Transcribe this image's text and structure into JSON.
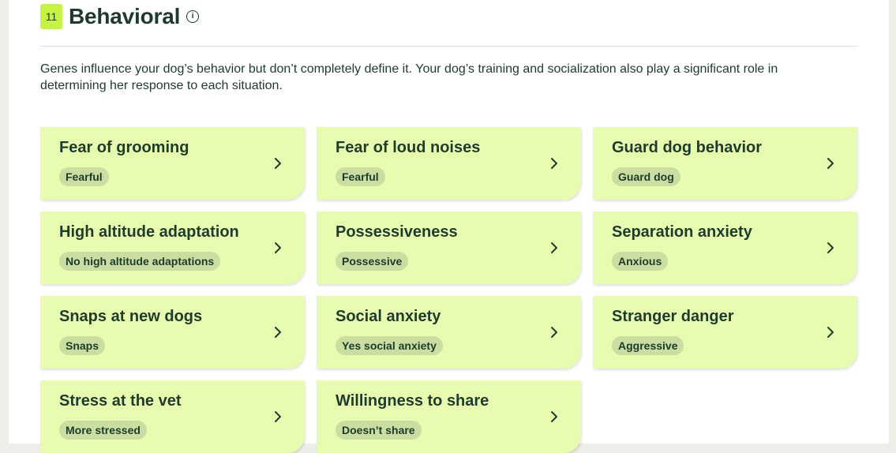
{
  "section": {
    "count": "11",
    "title": "Behavioral",
    "info_icon": "info-circle-icon",
    "description": "Genes influence your dog’s behavior but don’t completely define it. Your dog’s training and socialization also play a significant role in determining her response to each situation."
  },
  "colors": {
    "badge_count_bg": "#c5f542",
    "card_bg": "#e8fcb0",
    "pill_bg": "#c9dea0",
    "text": "#1d3b2c"
  },
  "cards": [
    {
      "title": "Fear of grooming",
      "result": "Fearful"
    },
    {
      "title": "Fear of loud noises",
      "result": "Fearful"
    },
    {
      "title": "Guard dog behavior",
      "result": "Guard dog"
    },
    {
      "title": "High altitude adaptation",
      "result": "No high altitude adaptations"
    },
    {
      "title": "Possessiveness",
      "result": "Possessive"
    },
    {
      "title": "Separation anxiety",
      "result": "Anxious"
    },
    {
      "title": "Snaps at new dogs",
      "result": "Snaps"
    },
    {
      "title": "Social anxiety",
      "result": "Yes social anxiety"
    },
    {
      "title": "Stranger danger",
      "result": "Aggressive"
    },
    {
      "title": "Stress at the vet",
      "result": "More stressed"
    },
    {
      "title": "Willingness to share",
      "result": "Doesn’t share"
    }
  ]
}
